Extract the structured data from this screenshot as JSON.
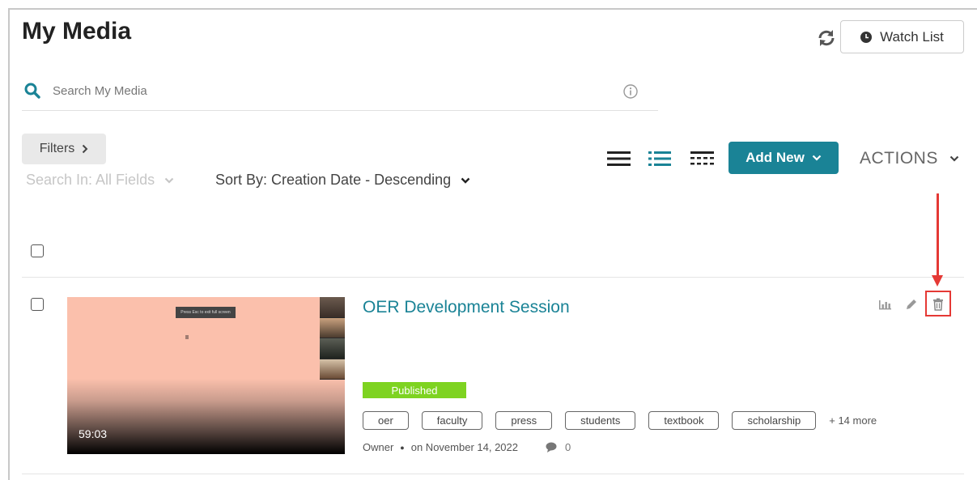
{
  "header": {
    "title": "My Media",
    "watch_list_label": "Watch List"
  },
  "search": {
    "placeholder": "Search My Media"
  },
  "filters": {
    "filters_label": "Filters",
    "search_in": "Search In: All Fields",
    "sort_by": "Sort By: Creation Date - Descending"
  },
  "toolbar": {
    "add_new_label": "Add New",
    "actions_label": "ACTIONS",
    "active_view": "detailed-list"
  },
  "entries": [
    {
      "title": "OER Development Session",
      "duration": "59:03",
      "thumbnail_caption": "Press Esc to exit full screen",
      "status": "Published",
      "tags": [
        "oer",
        "faculty",
        "press",
        "students",
        "textbook",
        "scholarship"
      ],
      "more_tags": "+ 14 more",
      "owner": "Owner",
      "date": "on November 14, 2022",
      "comments": "0"
    }
  ],
  "colors": {
    "accent": "#1a8396",
    "published": "#7ed321",
    "highlight": "#e53935"
  },
  "icons": {
    "refresh": "refresh-icon",
    "watch_list": "clock-icon",
    "search": "search-icon",
    "info": "info-icon",
    "analytics": "bar-chart-icon",
    "edit": "pencil-icon",
    "delete": "trash-icon",
    "comments": "comment-icon"
  }
}
